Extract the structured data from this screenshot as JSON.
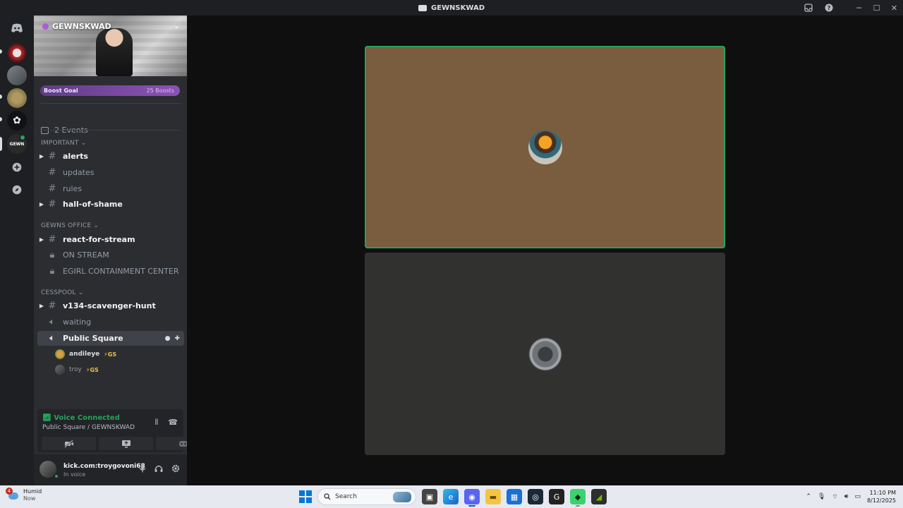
{
  "window": {
    "title": "GEWNSKWAD",
    "controls": [
      "inbox-icon",
      "help-icon",
      "minimize-icon",
      "maximize-icon",
      "close-icon"
    ]
  },
  "server": {
    "name": "GEWNSKWAD",
    "boost_goal": "Boost Goal",
    "boosts": "25 Boosts",
    "events": "2 Events"
  },
  "categories": [
    {
      "label": "IMPORTANT"
    },
    {
      "label": "GEWNS OFFICE"
    },
    {
      "label": "CESSPOOL"
    }
  ],
  "channels": [
    {
      "name": "alerts",
      "type": "text",
      "unread": true
    },
    {
      "name": "updates",
      "type": "text",
      "unread": false
    },
    {
      "name": "rules",
      "type": "text",
      "unread": false
    },
    {
      "name": "hall-of-shame",
      "type": "text",
      "unread": true
    },
    {
      "name": "react-for-stream",
      "type": "text",
      "unread": true
    },
    {
      "name": "ON STREAM",
      "type": "locked",
      "unread": false
    },
    {
      "name": "EGIRL CONTAINMENT CENTER",
      "type": "locked",
      "unread": false
    },
    {
      "name": "v134-scavenger-hunt",
      "type": "text",
      "unread": true
    },
    {
      "name": "waiting",
      "type": "voice",
      "unread": false
    },
    {
      "name": "Public Square",
      "type": "voice",
      "active": true
    }
  ],
  "voice_users": [
    {
      "name": "andileye",
      "tag": "⚡GS"
    },
    {
      "name": "troy",
      "tag": "⚡GS"
    }
  ],
  "voice_panel": {
    "status": "Voice Connected",
    "location": "Public Square / GEWNSKWAD"
  },
  "user": {
    "name": "kick.com:troygovoni68",
    "status": "In voice"
  },
  "taskbar": {
    "weather_title": "Humid",
    "weather_sub": "Now",
    "weather_badge": "4",
    "search_placeholder": "Search",
    "time": "11:10 PM",
    "date": "8/12/2025"
  },
  "colors": {
    "speaking": "#23a55a",
    "tile_active": "#7a5c3f",
    "tile_idle": "#313130",
    "accent": "#5865f2"
  }
}
